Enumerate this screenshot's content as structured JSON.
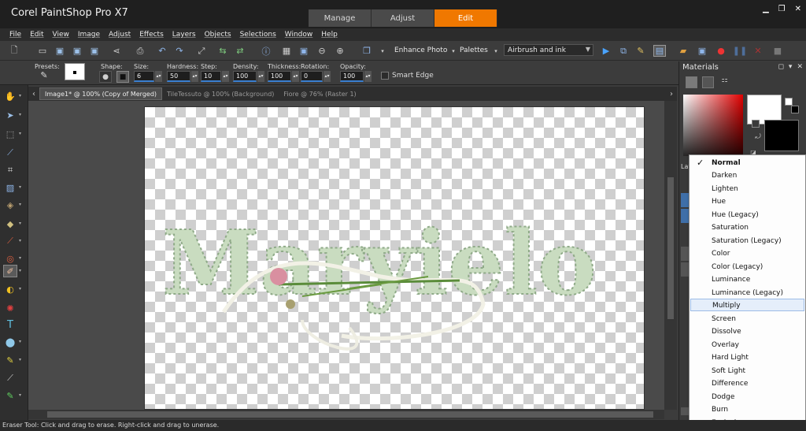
{
  "app": {
    "title": "Corel PaintShop Pro X7",
    "workspaces": [
      "Manage",
      "Adjust",
      "Edit"
    ],
    "active_workspace": "Edit"
  },
  "menu": [
    "File",
    "Edit",
    "View",
    "Image",
    "Adjust",
    "Effects",
    "Layers",
    "Objects",
    "Selections",
    "Window",
    "Help"
  ],
  "toolbar": {
    "enhance_photo": "Enhance Photo",
    "palettes": "Palettes",
    "workspace_select": "Airbrush and ink"
  },
  "tool_options": {
    "presets_label": "Presets:",
    "shape_label": "Shape:",
    "size_label": "Size:",
    "size_value": "6",
    "hardness_label": "Hardness:",
    "hardness_value": "50",
    "step_label": "Step:",
    "step_value": "10",
    "density_label": "Density:",
    "density_value": "100",
    "thickness_label": "Thickness:",
    "thickness_value": "100",
    "rotation_label": "Rotation:",
    "rotation_value": "0",
    "opacity_label": "Opacity:",
    "opacity_value": "100",
    "smart_edge_label": "Smart Edge"
  },
  "documents": [
    {
      "label": "Image1* @ 100% (Copy of Merged)",
      "active": true
    },
    {
      "label": "TileTessuto @ 100% (Background)",
      "active": false
    },
    {
      "label": "Fiore @  76% (Raster 1)",
      "active": false
    }
  ],
  "canvas": {
    "text": "Maryielo",
    "text_color": "#c9dcc0"
  },
  "materials_panel": {
    "title": "Materials",
    "foreground_color": "#ffffff",
    "background_color": "#000000"
  },
  "layers_panel": {
    "title_fragment": "Lay"
  },
  "blend_modes": {
    "selected": "Normal",
    "highlighted": "Multiply",
    "items": [
      "Normal",
      "Darken",
      "Lighten",
      "Hue",
      "Hue (Legacy)",
      "Saturation",
      "Saturation (Legacy)",
      "Color",
      "Color (Legacy)",
      "Luminance",
      "Luminance (Legacy)",
      "Multiply",
      "Screen",
      "Dissolve",
      "Overlay",
      "Hard Light",
      "Soft Light",
      "Difference",
      "Dodge",
      "Burn",
      "Exclusion"
    ]
  },
  "status_bar": {
    "text": "Eraser Tool: Click and drag to erase. Right-click and drag to unerase."
  },
  "colors": {
    "accent": "#f07800",
    "menu_highlight": "#e5eefa"
  }
}
